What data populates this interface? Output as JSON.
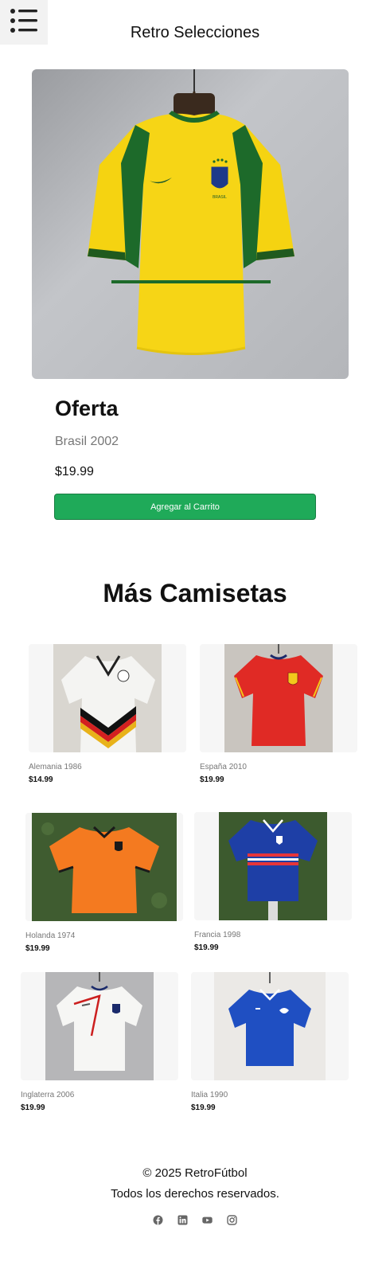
{
  "header": {
    "title": "Retro Selecciones",
    "menu_icon": "menu-icon"
  },
  "offer": {
    "heading": "Oferta",
    "name": "Brasil 2002",
    "price": "$19.99",
    "button_label": "Agregar al Carrito",
    "button_color": "#1faa59",
    "crest_text": "BRASIL"
  },
  "more": {
    "heading": "Más Camisetas",
    "items": [
      {
        "name": "Alemania 1986",
        "price": "$14.99"
      },
      {
        "name": "España 2010",
        "price": "$19.99"
      },
      {
        "name": "Holanda 1974",
        "price": "$19.99"
      },
      {
        "name": "Francia 1998",
        "price": "$19.99"
      },
      {
        "name": "Inglaterra 2006",
        "price": "$19.99"
      },
      {
        "name": "Italia 1990",
        "price": "$19.99"
      }
    ]
  },
  "footer": {
    "copyright": "© 2025 RetroFútbol",
    "rights": "Todos los derechos reservados.",
    "socials": [
      "facebook-icon",
      "linkedin-icon",
      "youtube-icon",
      "instagram-icon"
    ]
  }
}
